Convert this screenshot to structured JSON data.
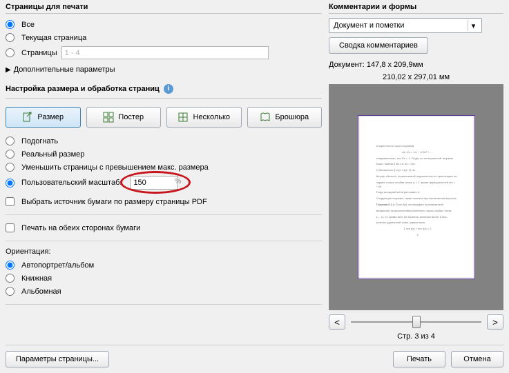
{
  "pagesToPrint": {
    "title": "Страницы для печати",
    "all": "Все",
    "current": "Текущая страница",
    "pages": "Страницы",
    "range": "1 - 4",
    "more": "Дополнительные параметры"
  },
  "sizing": {
    "title": "Настройка размера и обработка страниц",
    "sizeBtn": "Размер",
    "posterBtn": "Постер",
    "multipleBtn": "Несколько",
    "bookletBtn": "Брошюра",
    "fit": "Подогнать",
    "actual": "Реальный размер",
    "shrink": "Уменьшить страницы с превышением макс. размера",
    "custom": "Пользовательский масштаб:",
    "scaleValue": "150",
    "paperSource": "Выбрать источник бумаги по размеру страницы PDF",
    "duplex": "Печать на обеих сторонах бумаги"
  },
  "orientation": {
    "title": "Ориентация:",
    "auto": "Автопортрет/альбом",
    "portrait": "Книжная",
    "landscape": "Альбомная"
  },
  "comments": {
    "title": "Комментарии и формы",
    "selected": "Документ и пометки",
    "summarize": "Сводка комментариев"
  },
  "preview": {
    "docSize": "Документ: 147,8 x 209,9мм",
    "paperSize": "210,02 x 297,01 мм",
    "pageIndicator": "Стр. 3 из 4",
    "prev": "<",
    "next": ">"
  },
  "footer": {
    "pageSetup": "Параметры страницы...",
    "print": "Печать",
    "cancel": "Отмена"
  }
}
